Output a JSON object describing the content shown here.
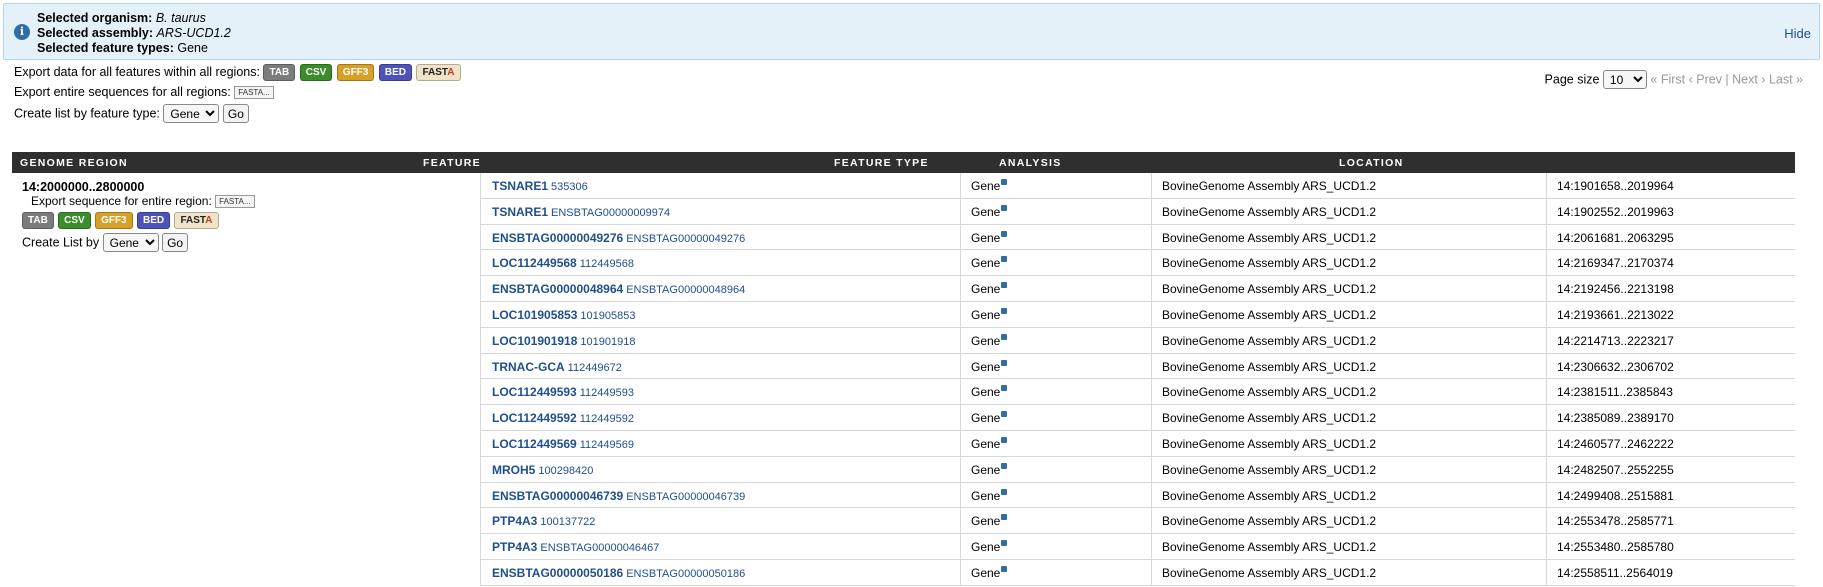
{
  "banner": {
    "organism_label": "Selected organism:",
    "organism_value": "B. taurus",
    "assembly_label": "Selected assembly:",
    "assembly_value": "ARS-UCD1.2",
    "feature_types_label": "Selected feature types:",
    "feature_types_value": "Gene",
    "hide": "Hide"
  },
  "export_all": {
    "label": "Export data for all features within all regions:",
    "buttons": {
      "tab": "TAB",
      "csv": "CSV",
      "gff": "GFF3",
      "bed": "BED",
      "fasta_a": "FAST",
      "fasta_b": "A"
    }
  },
  "export_seq": {
    "label": "Export entire sequences for all regions:",
    "fasta": "FASTA..."
  },
  "create_list": {
    "label": "Create list by feature type:",
    "selected": "Gene",
    "go": "Go"
  },
  "pager": {
    "page_size_label": "Page size",
    "page_size": "10",
    "nav": "« First ‹ Prev | Next › Last »"
  },
  "table": {
    "headers": [
      "GENOME REGION",
      "FEATURE",
      "FEATURE TYPE",
      "ANALYSIS",
      "LOCATION"
    ],
    "region": {
      "name": "14:2000000..2800000",
      "export_label": "Export sequence for entire region:",
      "fasta": "FASTA...",
      "buttons": {
        "tab": "TAB",
        "csv": "CSV",
        "gff": "GFF3",
        "bed": "BED",
        "fasta_a": "FAST",
        "fasta_b": "A"
      },
      "create_list_label": "Create List by",
      "create_list_selected": "Gene",
      "go": "Go"
    },
    "rows": [
      {
        "symbol": "TSNARE1",
        "id": "535306",
        "type": "Gene",
        "analysis": "BovineGenome Assembly ARS_UCD1.2",
        "location": "14:1901658..2019964"
      },
      {
        "symbol": "TSNARE1",
        "id": "ENSBTAG00000009974",
        "type": "Gene",
        "analysis": "BovineGenome Assembly ARS_UCD1.2",
        "location": "14:1902552..2019963"
      },
      {
        "symbol": "ENSBTAG00000049276",
        "id": "ENSBTAG00000049276",
        "type": "Gene",
        "analysis": "BovineGenome Assembly ARS_UCD1.2",
        "location": "14:2061681..2063295"
      },
      {
        "symbol": "LOC112449568",
        "id": "112449568",
        "type": "Gene",
        "analysis": "BovineGenome Assembly ARS_UCD1.2",
        "location": "14:2169347..2170374"
      },
      {
        "symbol": "ENSBTAG00000048964",
        "id": "ENSBTAG00000048964",
        "type": "Gene",
        "analysis": "BovineGenome Assembly ARS_UCD1.2",
        "location": "14:2192456..2213198"
      },
      {
        "symbol": "LOC101905853",
        "id": "101905853",
        "type": "Gene",
        "analysis": "BovineGenome Assembly ARS_UCD1.2",
        "location": "14:2193661..2213022"
      },
      {
        "symbol": "LOC101901918",
        "id": "101901918",
        "type": "Gene",
        "analysis": "BovineGenome Assembly ARS_UCD1.2",
        "location": "14:2214713..2223217"
      },
      {
        "symbol": "TRNAC-GCA",
        "id": "112449672",
        "type": "Gene",
        "analysis": "BovineGenome Assembly ARS_UCD1.2",
        "location": "14:2306632..2306702"
      },
      {
        "symbol": "LOC112449593",
        "id": "112449593",
        "type": "Gene",
        "analysis": "BovineGenome Assembly ARS_UCD1.2",
        "location": "14:2381511..2385843"
      },
      {
        "symbol": "LOC112449592",
        "id": "112449592",
        "type": "Gene",
        "analysis": "BovineGenome Assembly ARS_UCD1.2",
        "location": "14:2385089..2389170"
      },
      {
        "symbol": "LOC112449569",
        "id": "112449569",
        "type": "Gene",
        "analysis": "BovineGenome Assembly ARS_UCD1.2",
        "location": "14:2460577..2462222"
      },
      {
        "symbol": "MROH5",
        "id": "100298420",
        "type": "Gene",
        "analysis": "BovineGenome Assembly ARS_UCD1.2",
        "location": "14:2482507..2552255"
      },
      {
        "symbol": "ENSBTAG00000046739",
        "id": "ENSBTAG00000046739",
        "type": "Gene",
        "analysis": "BovineGenome Assembly ARS_UCD1.2",
        "location": "14:2499408..2515881"
      },
      {
        "symbol": "PTP4A3",
        "id": "100137722",
        "type": "Gene",
        "analysis": "BovineGenome Assembly ARS_UCD1.2",
        "location": "14:2553478..2585771"
      },
      {
        "symbol": "PTP4A3",
        "id": "ENSBTAG00000046467",
        "type": "Gene",
        "analysis": "BovineGenome Assembly ARS_UCD1.2",
        "location": "14:2553480..2585780"
      },
      {
        "symbol": "ENSBTAG00000050186",
        "id": "ENSBTAG00000050186",
        "type": "Gene",
        "analysis": "BovineGenome Assembly ARS_UCD1.2",
        "location": "14:2558511..2564019"
      }
    ]
  }
}
